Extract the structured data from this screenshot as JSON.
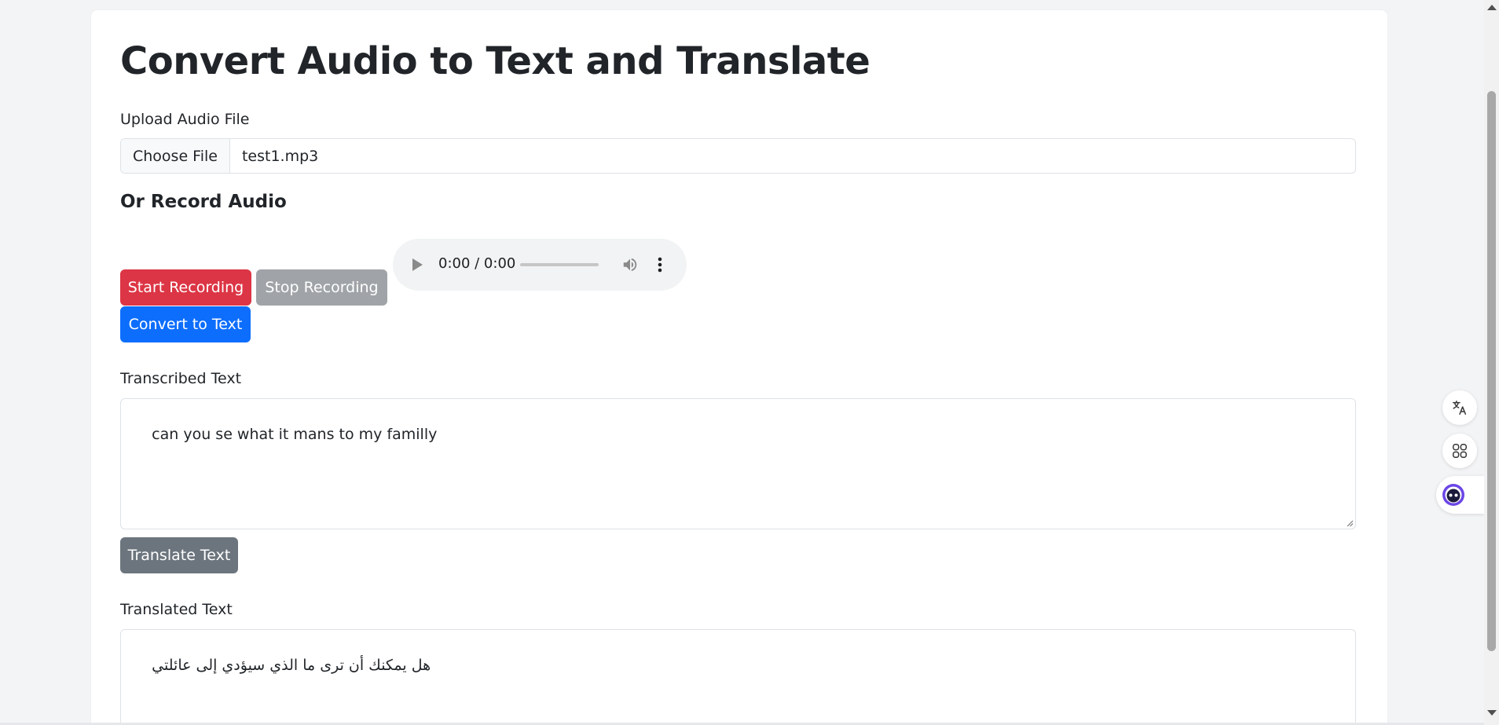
{
  "page": {
    "title": "Convert Audio to Text and Translate"
  },
  "upload": {
    "label": "Upload Audio File",
    "choose_button": "Choose File",
    "file_name": "test1.mp3"
  },
  "record": {
    "heading": "Or Record Audio",
    "start_button": "Start Recording",
    "stop_button": "Stop Recording",
    "convert_button": "Convert to Text",
    "player": {
      "time": "0:00 / 0:00",
      "progress": 0
    }
  },
  "transcribed": {
    "label": "Transcribed Text",
    "value": "can you se what it mans to my familly"
  },
  "translate": {
    "button": "Translate Text"
  },
  "translated": {
    "label": "Translated Text",
    "value": "هل يمكنك أن ترى ما الذي سيؤدي إلى عائلتي"
  },
  "side_widgets": [
    "translate-icon",
    "apps-icon",
    "assistant-icon"
  ],
  "colors": {
    "danger": "#dc3545",
    "secondary_disabled": "#a0a4a8",
    "primary": "#0d6efd",
    "secondary": "#6c757d",
    "assistant_accent": "#6b46e5"
  }
}
